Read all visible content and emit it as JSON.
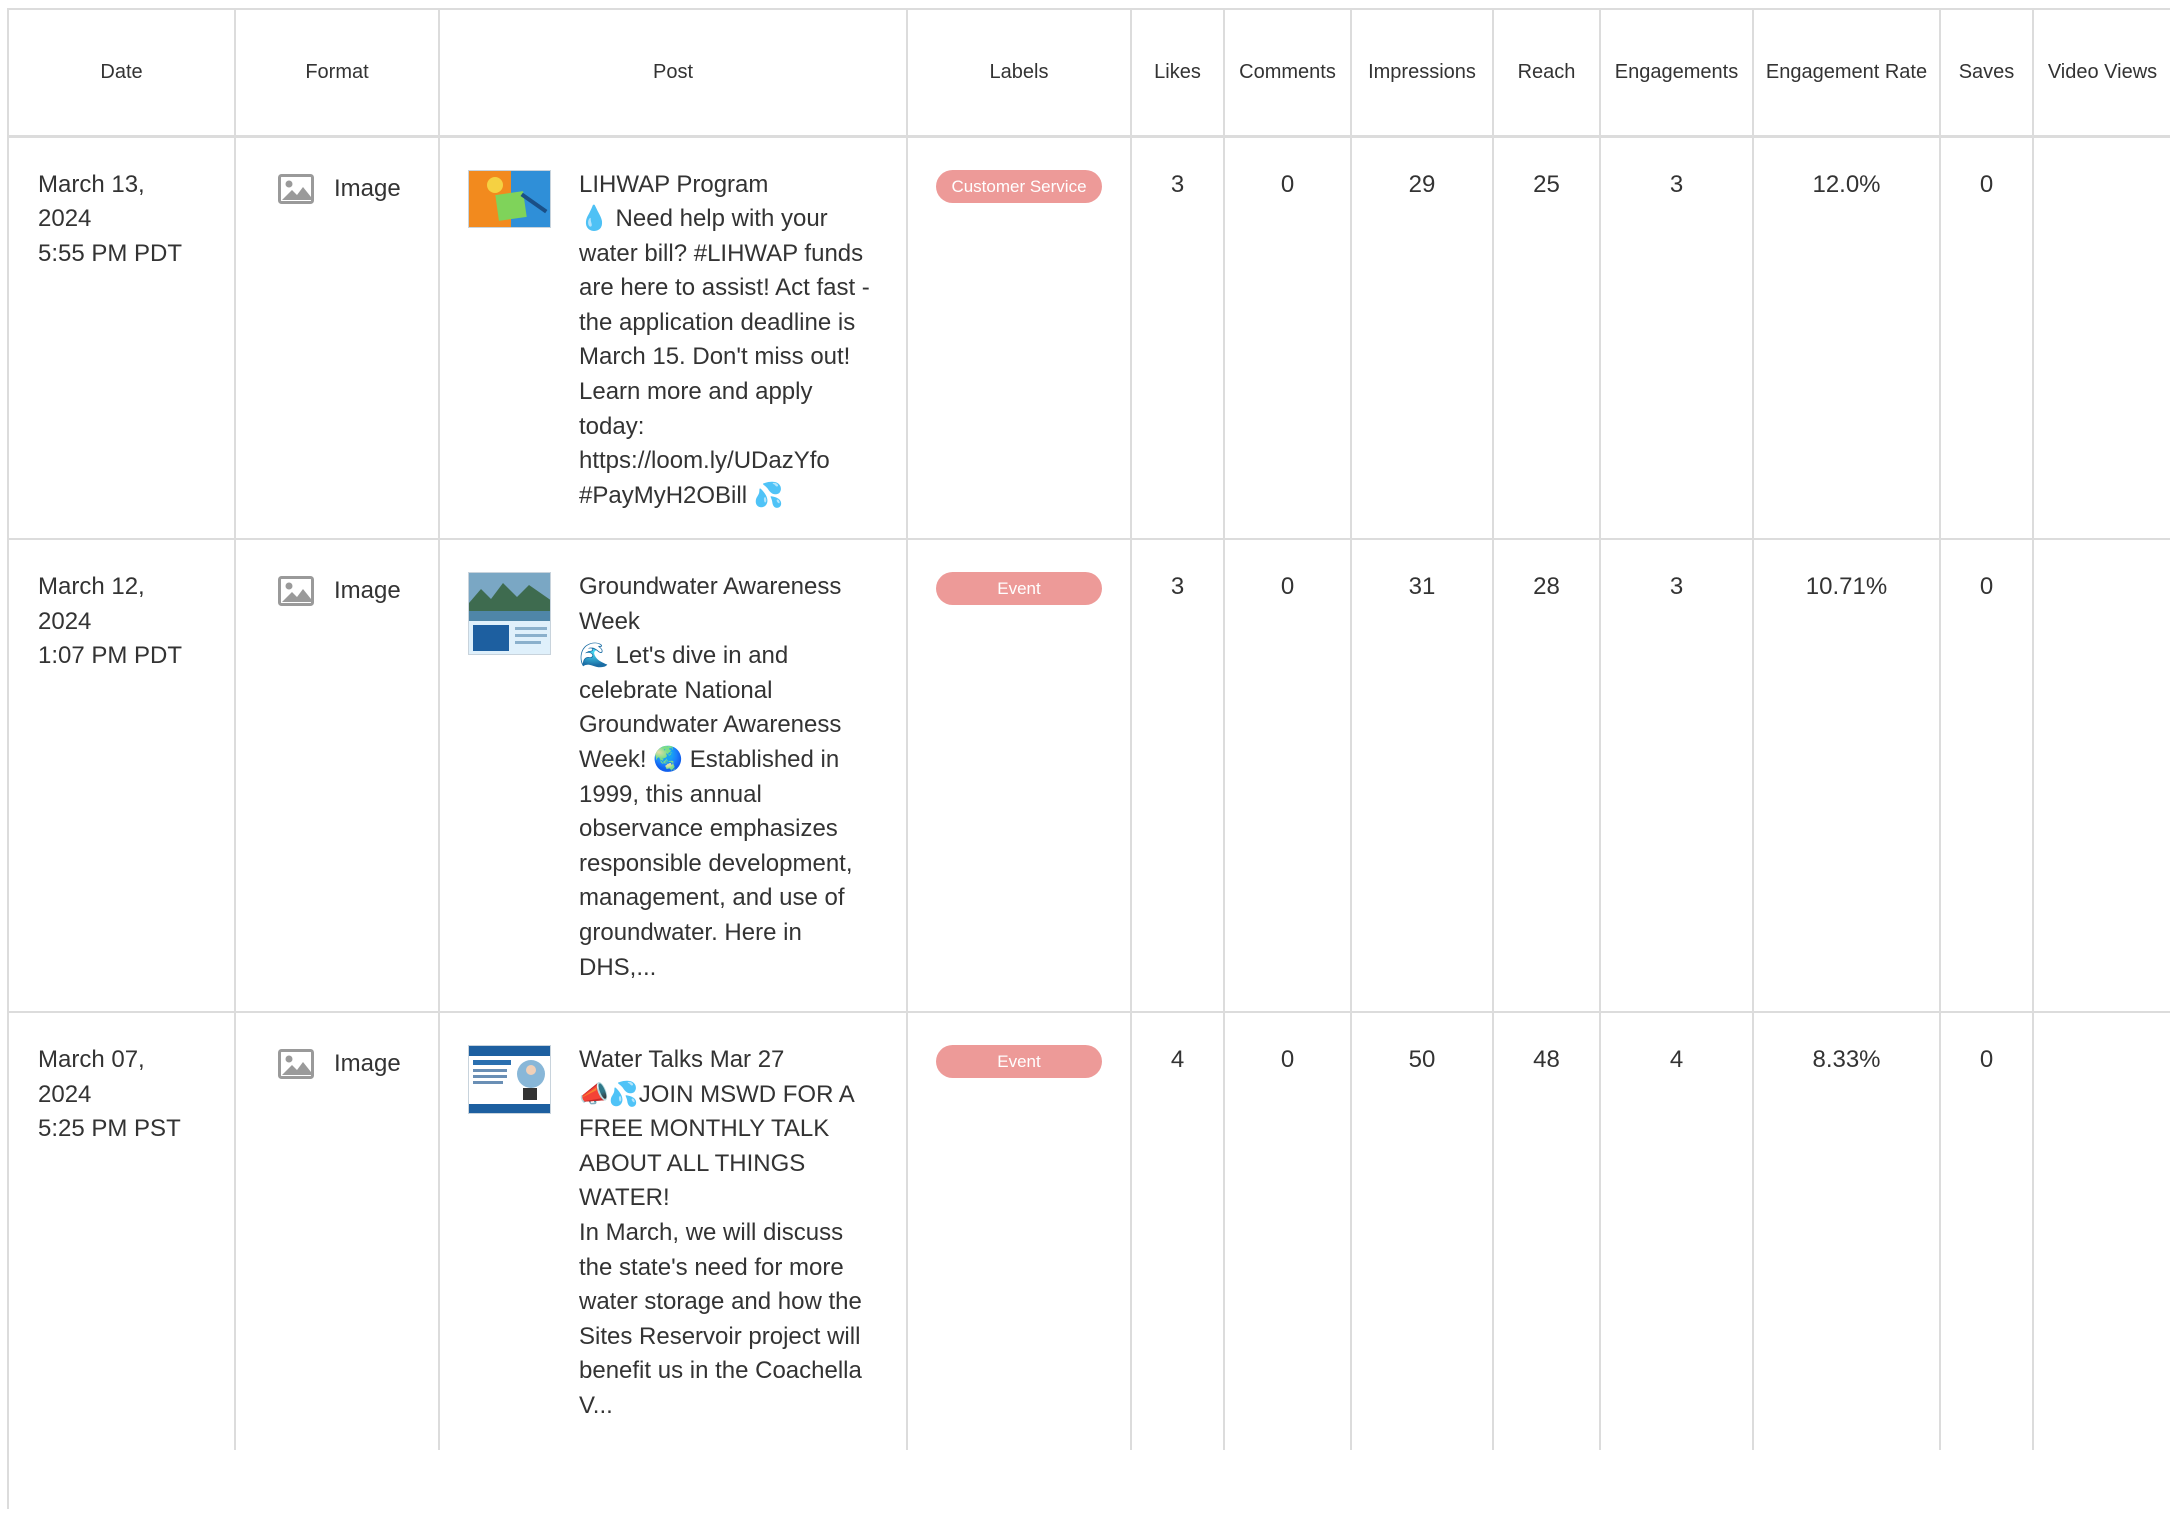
{
  "columns": [
    "Date",
    "Format",
    "Post",
    "Labels",
    "Likes",
    "Comments",
    "Impressions",
    "Reach",
    "Engagements",
    "Engagement Rate",
    "Saves",
    "Video Views"
  ],
  "rows": [
    {
      "date": "March 13,\n2024\n5:55 PM PDT",
      "format": "Image",
      "format_icon": "image-icon",
      "post_title": "LIHWAP Program",
      "post_body": "💧 Need help with your water bill? #LIHWAP funds are here to assist! Act fast - the application deadline is March 15. Don't miss out! Learn more and apply today:\nhttps://loom.ly/UDazYfo\n#PayMyH2OBill 💦",
      "label": "Customer Service",
      "label_color": "#ed9a98",
      "likes": "3",
      "comments": "0",
      "impressions": "29",
      "reach": "25",
      "engagements": "3",
      "engagement_rate": "12.0%",
      "saves": "0",
      "video_views": ""
    },
    {
      "date": "March 12,\n2024\n1:07 PM PDT",
      "format": "Image",
      "format_icon": "image-icon",
      "post_title": "Groundwater Awareness Week",
      "post_body": "🌊 Let's dive in and celebrate National Groundwater Awareness Week! 🌏 Established in 1999, this annual observance emphasizes responsible development, management, and use of groundwater. Here in DHS,...",
      "label": "Event",
      "label_color": "#ed9a98",
      "likes": "3",
      "comments": "0",
      "impressions": "31",
      "reach": "28",
      "engagements": "3",
      "engagement_rate": "10.71%",
      "saves": "0",
      "video_views": ""
    },
    {
      "date": "March 07,\n2024\n5:25 PM PST",
      "format": "Image",
      "format_icon": "image-icon",
      "post_title": "Water Talks Mar 27",
      "post_body": "📣💦JOIN MSWD FOR A FREE MONTHLY TALK ABOUT ALL THINGS WATER!\nIn March, we will discuss the state's need for more water storage and how the Sites Reservoir project will benefit us in the Coachella V...",
      "label": "Event",
      "label_color": "#ed9a98",
      "likes": "4",
      "comments": "0",
      "impressions": "50",
      "reach": "48",
      "engagements": "4",
      "engagement_rate": "8.33%",
      "saves": "0",
      "video_views": ""
    }
  ],
  "colors": {
    "grid": "#dcdcdc",
    "badge": "#ed9a98",
    "text": "#333333"
  }
}
